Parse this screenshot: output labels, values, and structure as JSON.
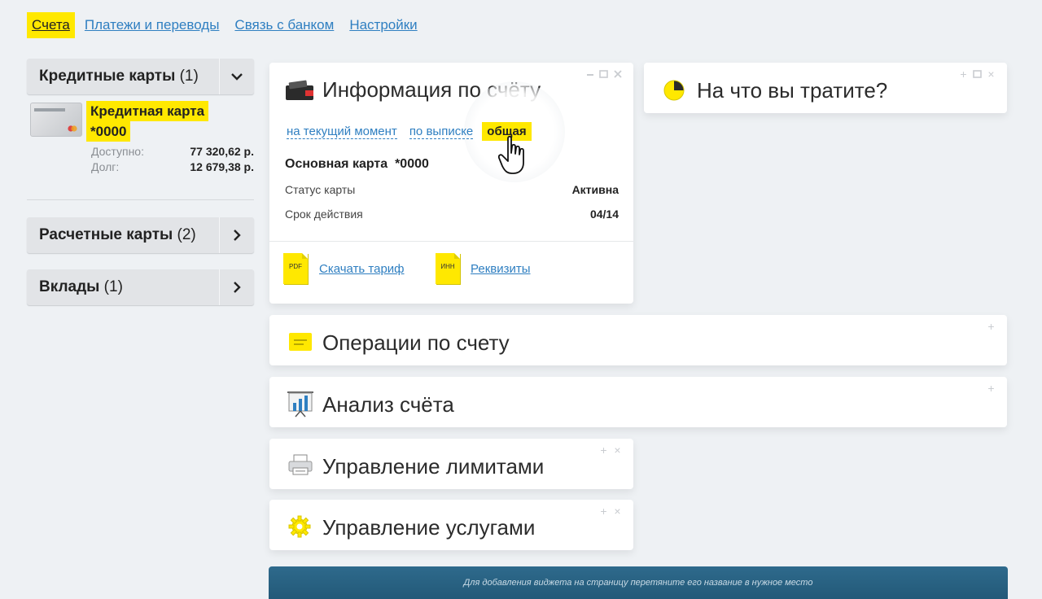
{
  "nav": {
    "items": [
      "Счета",
      "Платежи и переводы",
      "Связь с банком",
      "Настройки"
    ],
    "active_index": 0
  },
  "sidebar": {
    "credit": {
      "label": "Кредитные карты",
      "count": "(1)"
    },
    "card": {
      "title_line1": "Кредитная карта",
      "title_line2": "*0000",
      "available_label": "Доступно:",
      "available_value": "77 320,62 р.",
      "debt_label": "Долг:",
      "debt_value": "12 679,38 р."
    },
    "settlement": {
      "label": "Расчетные карты",
      "count": "(2)"
    },
    "deposits": {
      "label": "Вклады",
      "count": "(1)"
    }
  },
  "info_widget": {
    "title": "Информация по счёту",
    "tabs": [
      "на текущий момент",
      "по выписке",
      "общая"
    ],
    "active_tab": 2,
    "main_card_label": "Основная карта",
    "main_card_number": "*0000",
    "status_label": "Статус карты",
    "status_value": "Активна",
    "expiry_label": "Срок действия",
    "expiry_value": "04/14",
    "doc1_icon_text": "PDF",
    "doc1_link": "Скачать тариф",
    "doc2_icon_text": "ИНН",
    "doc2_link": "Реквизиты"
  },
  "spend_widget": {
    "title": "На что вы тратите?"
  },
  "widgets": {
    "operations": "Операции по счету",
    "analysis": "Анализ счёта",
    "limits": "Управление лимитами",
    "services": "Управление услугами"
  },
  "controls": {
    "plus": "+",
    "close": "×"
  },
  "footer": {
    "hint": "Для добавления виджета на страницу перетяните его название в нужное место"
  },
  "colors": {
    "accent_yellow": "#ffe800",
    "link_blue": "#2f7fc1",
    "footer_blue": "#2a6586"
  },
  "icons": [
    "chevron-down-icon",
    "chevron-right-icon",
    "wallet-icon",
    "pie-chart-icon",
    "folder-icon",
    "bar-chart-icon",
    "printer-icon",
    "gear-icon",
    "hand-cursor-icon"
  ]
}
